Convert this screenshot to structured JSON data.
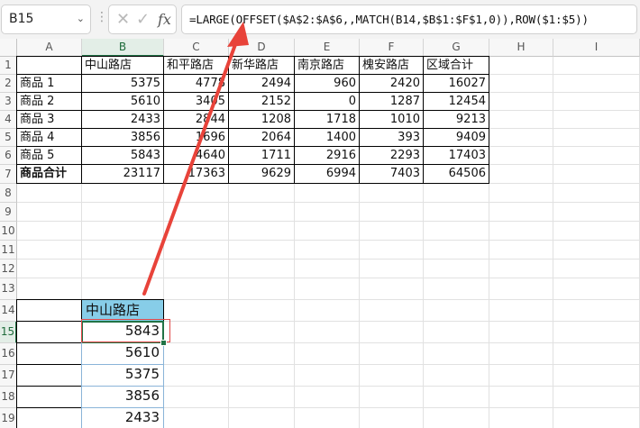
{
  "name_box": {
    "value": "B15"
  },
  "formula_bar": {
    "formula": "=LARGE(OFFSET($A$2:$A$6,,MATCH(B14,$B$1:$F$1,0)),ROW($1:$5))",
    "cancel_icon": "x-icon",
    "confirm_icon": "check-icon",
    "fx_label": "fx"
  },
  "columns": [
    "A",
    "B",
    "C",
    "D",
    "E",
    "F",
    "G",
    "H",
    "I"
  ],
  "rows": [
    "1",
    "2",
    "3",
    "4",
    "5",
    "6",
    "7",
    "8",
    "9",
    "10",
    "11",
    "12",
    "13",
    "14",
    "15",
    "16",
    "17",
    "18",
    "19"
  ],
  "table": {
    "headers": [
      "中山路店",
      "和平路店",
      "新华路店",
      "南京路店",
      "槐安路店",
      "区域合计"
    ],
    "rows": [
      {
        "label": "商品 1",
        "values": [
          "5375",
          "4778",
          "2494",
          "960",
          "2420",
          "16027"
        ]
      },
      {
        "label": "商品 2",
        "values": [
          "5610",
          "3405",
          "2152",
          "0",
          "1287",
          "12454"
        ]
      },
      {
        "label": "商品 3",
        "values": [
          "2433",
          "2844",
          "1208",
          "1718",
          "1010",
          "9213"
        ]
      },
      {
        "label": "商品 4",
        "values": [
          "3856",
          "1696",
          "2064",
          "1400",
          "393",
          "9409"
        ]
      },
      {
        "label": "商品 5",
        "values": [
          "5843",
          "4640",
          "1711",
          "2916",
          "2293",
          "17403"
        ]
      }
    ],
    "total_row": {
      "label": "商品合计",
      "values": [
        "23117",
        "17363",
        "9629",
        "6994",
        "7403",
        "64506"
      ]
    }
  },
  "result": {
    "header": "中山路店",
    "values": [
      "5843",
      "5610",
      "5375",
      "3856",
      "2433"
    ]
  },
  "colors": {
    "accent": "#217346",
    "arrow": "#e8433a",
    "header_fill": "#87cde8"
  }
}
